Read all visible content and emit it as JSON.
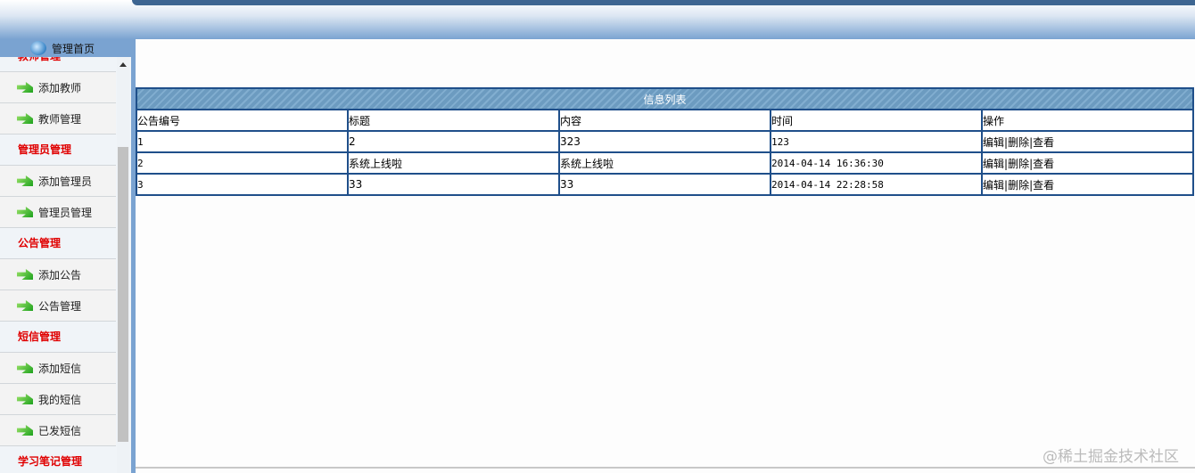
{
  "header": {
    "home_label": "管理首页"
  },
  "sidebar": {
    "groups": [
      {
        "title": "教师管理",
        "items": [
          "添加教师",
          "教师管理"
        ]
      },
      {
        "title": "管理员管理",
        "items": [
          "添加管理员",
          "管理员管理"
        ]
      },
      {
        "title": "公告管理",
        "items": [
          "添加公告",
          "公告管理"
        ]
      },
      {
        "title": "短信管理",
        "items": [
          "添加短信",
          "我的短信",
          "已发短信"
        ]
      },
      {
        "title": "学习笔记管理",
        "items": []
      }
    ]
  },
  "table": {
    "caption": "信息列表",
    "columns": [
      "公告编号",
      "标题",
      "内容",
      "时间",
      "操作"
    ],
    "rows": [
      {
        "id": "1",
        "title": "2",
        "content": "323",
        "time": "123"
      },
      {
        "id": "2",
        "title": "系统上线啦",
        "content": "系统上线啦",
        "time": "2014-04-14 16:36:30"
      },
      {
        "id": "3",
        "title": "33",
        "content": "33",
        "time": "2014-04-14 22:28:58"
      }
    ],
    "actions": {
      "edit": "编辑",
      "delete": "删除",
      "view": "查看",
      "sep": "|"
    }
  },
  "watermark": "@稀土掘金技术社区"
}
